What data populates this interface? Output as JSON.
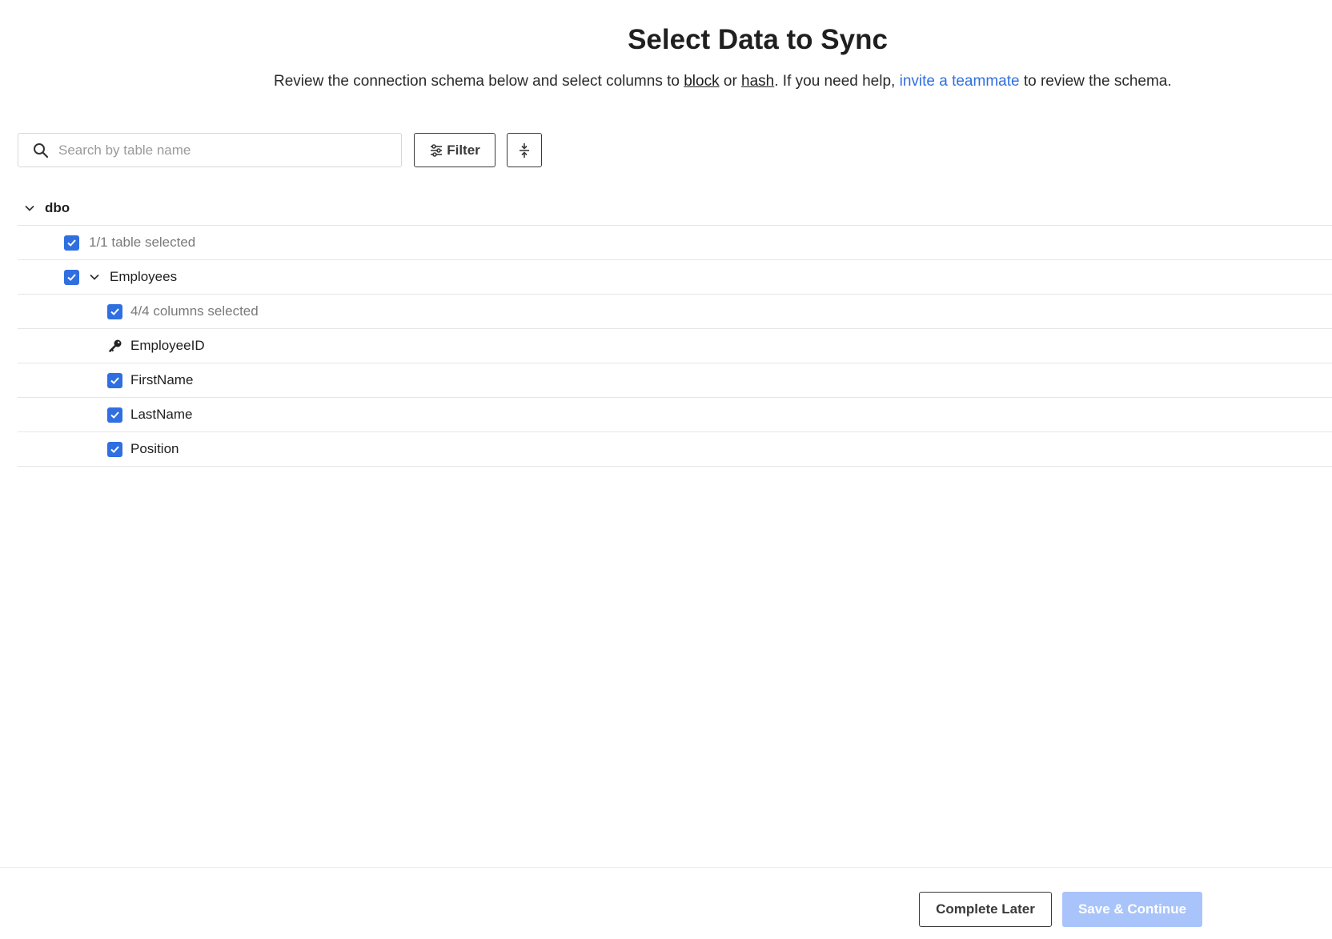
{
  "header": {
    "title": "Select Data to Sync",
    "subtitle": {
      "part1": "Review the connection schema below and select columns to ",
      "block_link": "block",
      "part2": " or ",
      "hash_link": "hash",
      "part3": ". If you need help, ",
      "invite_link": "invite a teammate",
      "part4": " to review the schema."
    }
  },
  "toolbar": {
    "search_placeholder": "Search by table name",
    "search_value": "",
    "filter_label": "Filter",
    "search_icon": "search-icon",
    "filter_icon": "sliders-icon",
    "collapse_icon": "collapse-all-icon"
  },
  "tree": {
    "schema": {
      "name": "dbo",
      "expanded": true
    },
    "table_summary": {
      "text": "1/1 table selected",
      "checked": true
    },
    "table": {
      "name": "Employees",
      "checked": true,
      "expanded": true
    },
    "column_summary": {
      "text": "4/4 columns selected",
      "checked": true
    },
    "columns": [
      {
        "name": "EmployeeID",
        "icon": "key-icon",
        "primary_key": true
      },
      {
        "name": "FirstName",
        "checked": true
      },
      {
        "name": "LastName",
        "checked": true
      },
      {
        "name": "Position",
        "checked": true
      }
    ]
  },
  "footer": {
    "complete_later_label": "Complete Later",
    "save_continue_label": "Save & Continue",
    "save_enabled": false
  },
  "colors": {
    "accent": "#2f6fe0",
    "disabled_button": "#a9c4fb",
    "divider": "#e6e6e6"
  }
}
